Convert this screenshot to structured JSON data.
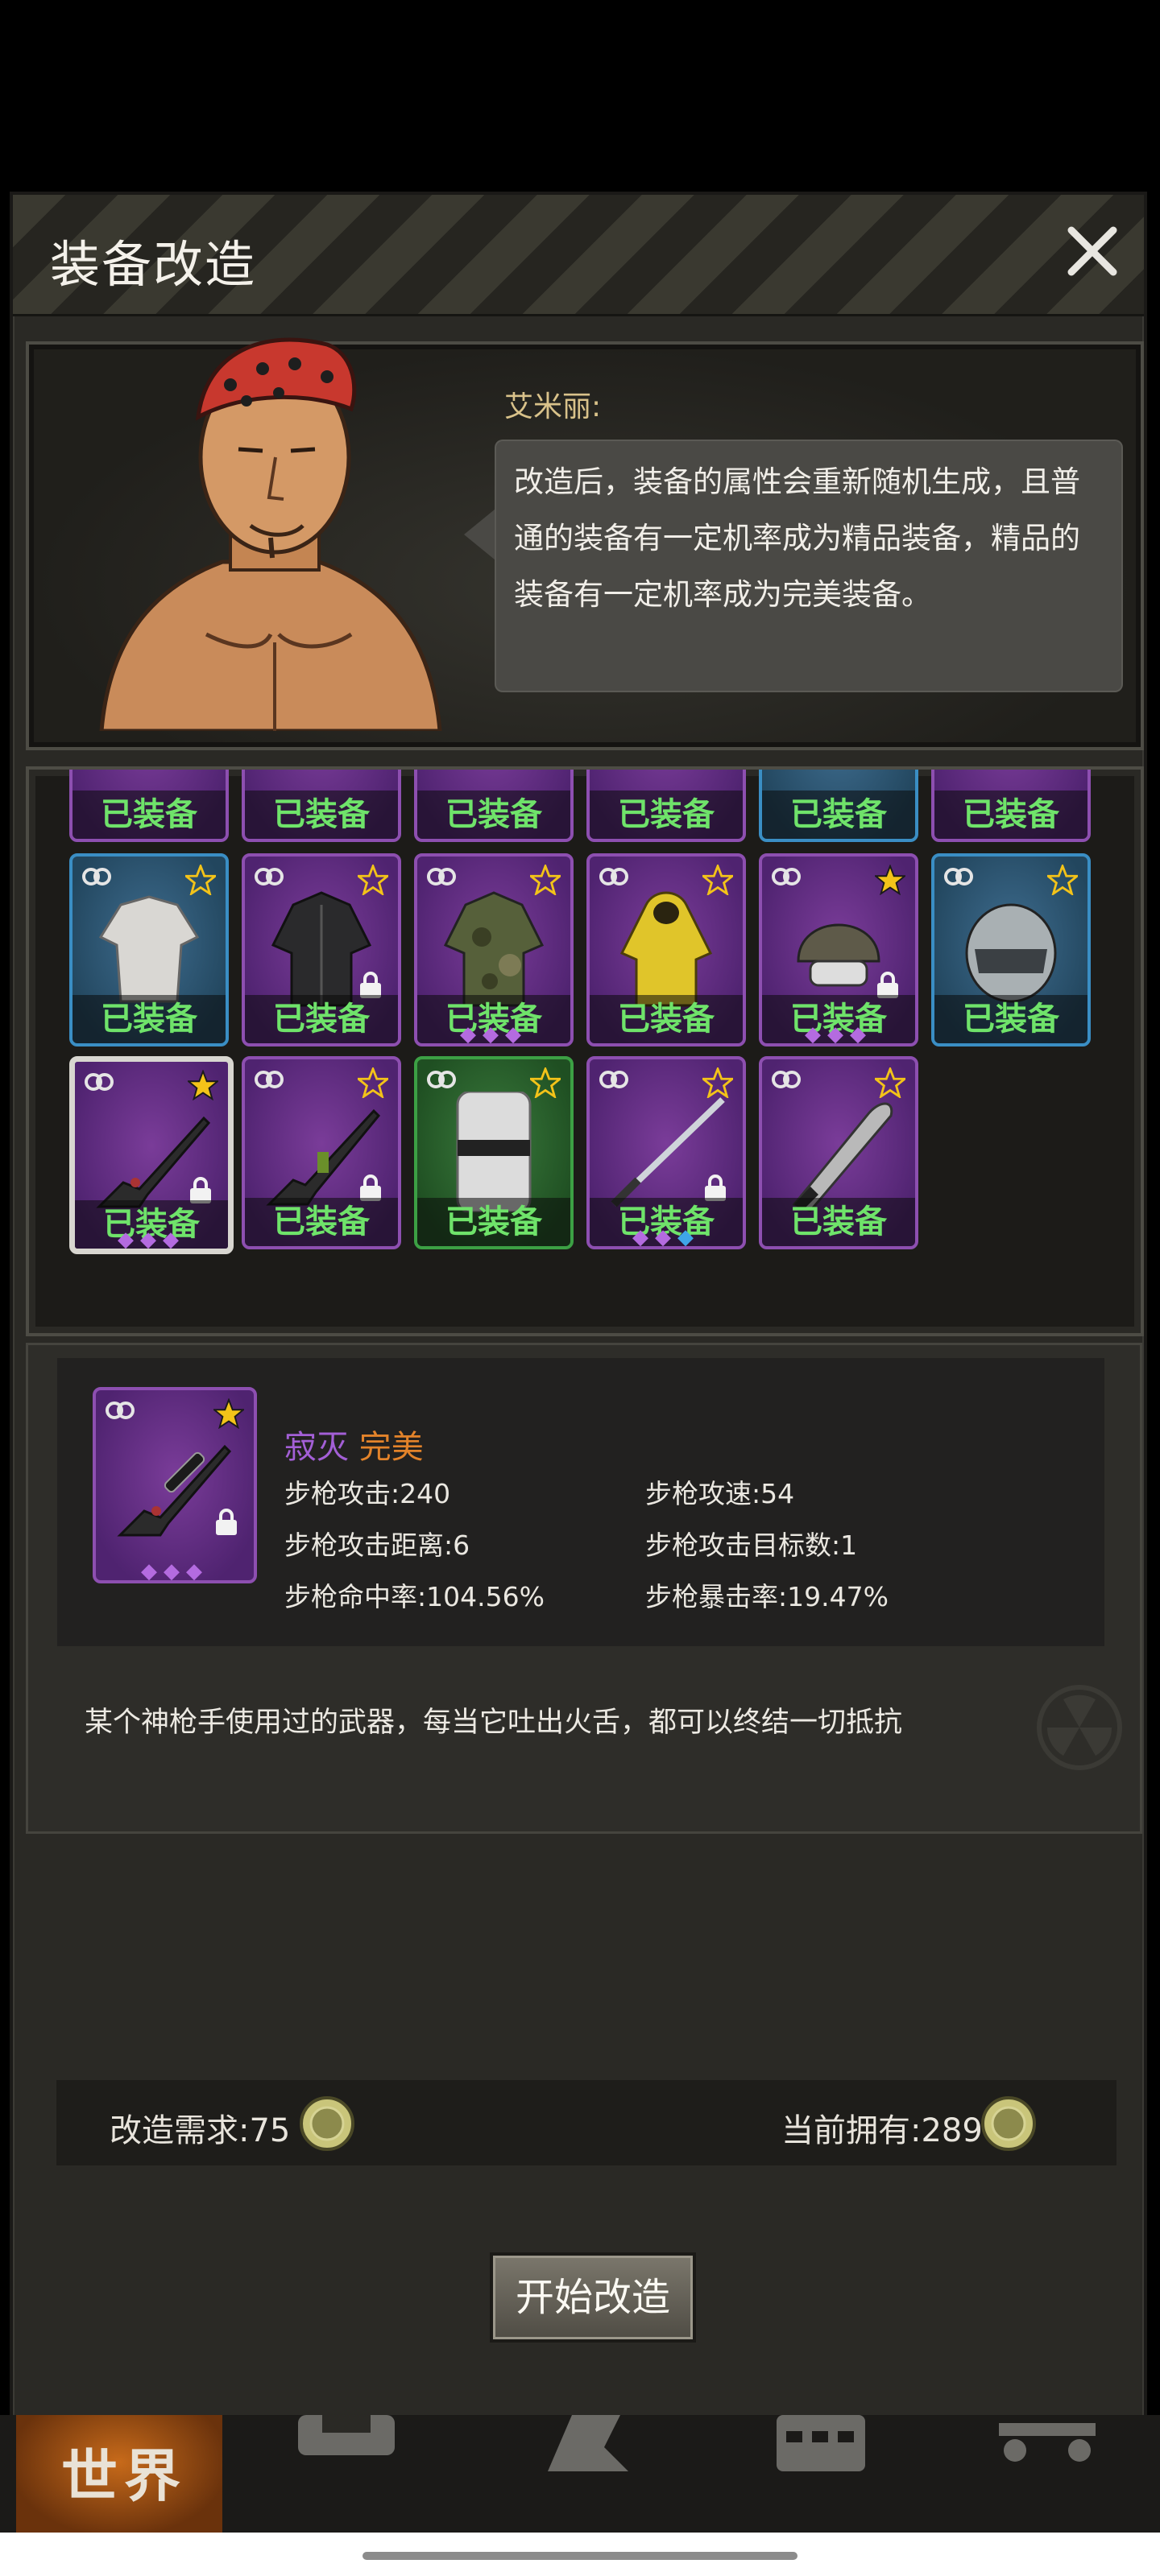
{
  "dialog": {
    "title": "装备改造"
  },
  "npc": {
    "name": "艾米丽:",
    "speech": "改造后，装备的属性会重新随机生成，且普通的装备有一定机率成为精品装备，精品的装备有一定机率成为完美装备。"
  },
  "inventory": {
    "equipped_label": "已装备",
    "row0": [
      {
        "rarity": "purple"
      },
      {
        "rarity": "purple"
      },
      {
        "rarity": "purple"
      },
      {
        "rarity": "purple"
      },
      {
        "rarity": "blue"
      },
      {
        "rarity": "purple"
      }
    ],
    "row1": [
      {
        "rarity": "blue",
        "item": "shirt-icon",
        "locked": false,
        "gems": 0
      },
      {
        "rarity": "purple",
        "item": "jacket-icon",
        "locked": true,
        "gems": 0
      },
      {
        "rarity": "purple",
        "item": "camo-jacket-icon",
        "locked": false,
        "gems": 3
      },
      {
        "rarity": "purple",
        "item": "raincoat-icon",
        "locked": false,
        "gems": 0
      },
      {
        "rarity": "purple",
        "item": "tactical-helmet-icon",
        "locked": true,
        "gems": 3
      },
      {
        "rarity": "blue",
        "item": "motorcycle-helmet-icon",
        "locked": false,
        "gems": 0
      }
    ],
    "row2": [
      {
        "rarity": "purple",
        "item": "sniper-rifle-icon",
        "locked": true,
        "gems": 3,
        "selected": true
      },
      {
        "rarity": "purple",
        "item": "assault-rifle-icon",
        "locked": true,
        "gems": 0
      },
      {
        "rarity": "green",
        "item": "riot-shield-icon",
        "locked": false,
        "gems": 0
      },
      {
        "rarity": "purple",
        "item": "katana-icon",
        "locked": true,
        "gems": 3
      },
      {
        "rarity": "purple",
        "item": "machete-icon",
        "locked": false,
        "gems": 0
      }
    ]
  },
  "detail": {
    "name": "寂灭",
    "quality": "完美",
    "name_color": "#a35fd6",
    "quality_color": "#e3832a",
    "stats": [
      {
        "label": "步枪攻击",
        "value": "240"
      },
      {
        "label": "步枪攻速",
        "value": "54"
      },
      {
        "label": "步枪攻击距离",
        "value": "6"
      },
      {
        "label": "步枪攻击目标数",
        "value": "1"
      },
      {
        "label": "步枪命中率",
        "value": "104.56%"
      },
      {
        "label": "步枪暴击率",
        "value": "19.47%"
      }
    ],
    "description": "某个神枪手使用过的武器，每当它吐出火舌，都可以终结一切抵抗"
  },
  "cost": {
    "required_label": "改造需求",
    "required_value": ":75",
    "owned_label": "当前拥有",
    "owned_value": ":289"
  },
  "start_button": "开始改造",
  "nav": {
    "world": "世界"
  }
}
